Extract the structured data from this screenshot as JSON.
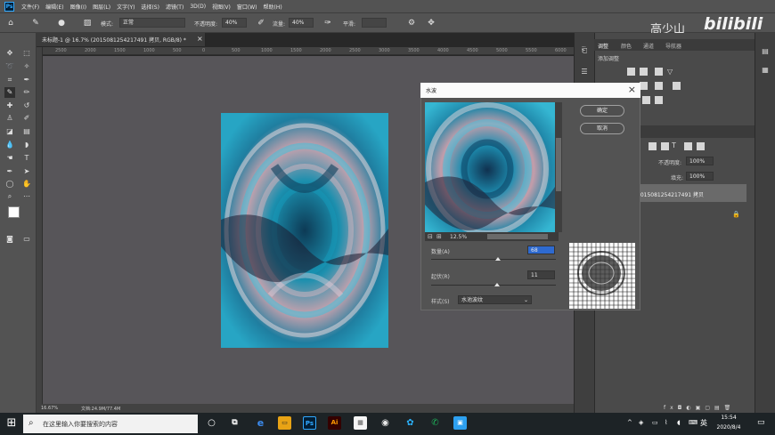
{
  "app": {
    "menu_items": [
      "文件(F)",
      "编辑(E)",
      "图像(I)",
      "图层(L)",
      "文字(Y)",
      "选择(S)",
      "滤镜(T)",
      "3D(D)",
      "视图(V)",
      "窗口(W)",
      "帮助(H)"
    ]
  },
  "options_bar": {
    "mode_label": "模式:",
    "mode_value": "正常",
    "opacity_label": "不透明度:",
    "opacity_value": "40%",
    "flow_label": "流量:",
    "flow_value": "40%",
    "smooth_label": "平滑:"
  },
  "watermark": {
    "name": "高少山",
    "logo": "bilibili"
  },
  "document": {
    "tab_title": "未标题-1 @ 16.7% (2015081254217491 拷贝, RGB/8) *",
    "ruler_ticks": [
      "2500",
      "2000",
      "1500",
      "1000",
      "500",
      "0",
      "500",
      "1000",
      "1500",
      "2000",
      "2500",
      "3000",
      "3500",
      "4000",
      "4500",
      "5000",
      "5500",
      "6000",
      "6500"
    ],
    "status_zoom": "16.67%",
    "status_doc": "文档:24.9M/77.4M"
  },
  "right_panel": {
    "tabs": [
      "调整",
      "颜色",
      "通道",
      "导航器"
    ],
    "add_adjustment": "添加调整",
    "opacity_label": "不透明度:",
    "opacity_value": "100%",
    "fill_label": "填充:",
    "fill_value": "100%",
    "layer_name": "2015081254217491 拷贝"
  },
  "dialog": {
    "title": "水波",
    "ok_label": "确定",
    "cancel_label": "取消",
    "zoom": "12.5%",
    "amount_label": "数量(A)",
    "amount_value": "68",
    "ridges_label": "起伏(R)",
    "ridges_value": "11",
    "style_label": "样式(S)",
    "style_value": "水池波纹"
  },
  "taskbar": {
    "search_placeholder": "在这里输入你要搜索的内容",
    "ime": "英",
    "time": "15:54",
    "date": "2020/8/4"
  },
  "colors": {
    "ps_blue": "#31a8ff",
    "artwork_teal": "#1a8da8",
    "artwork_pink": "#c9a0ac"
  }
}
